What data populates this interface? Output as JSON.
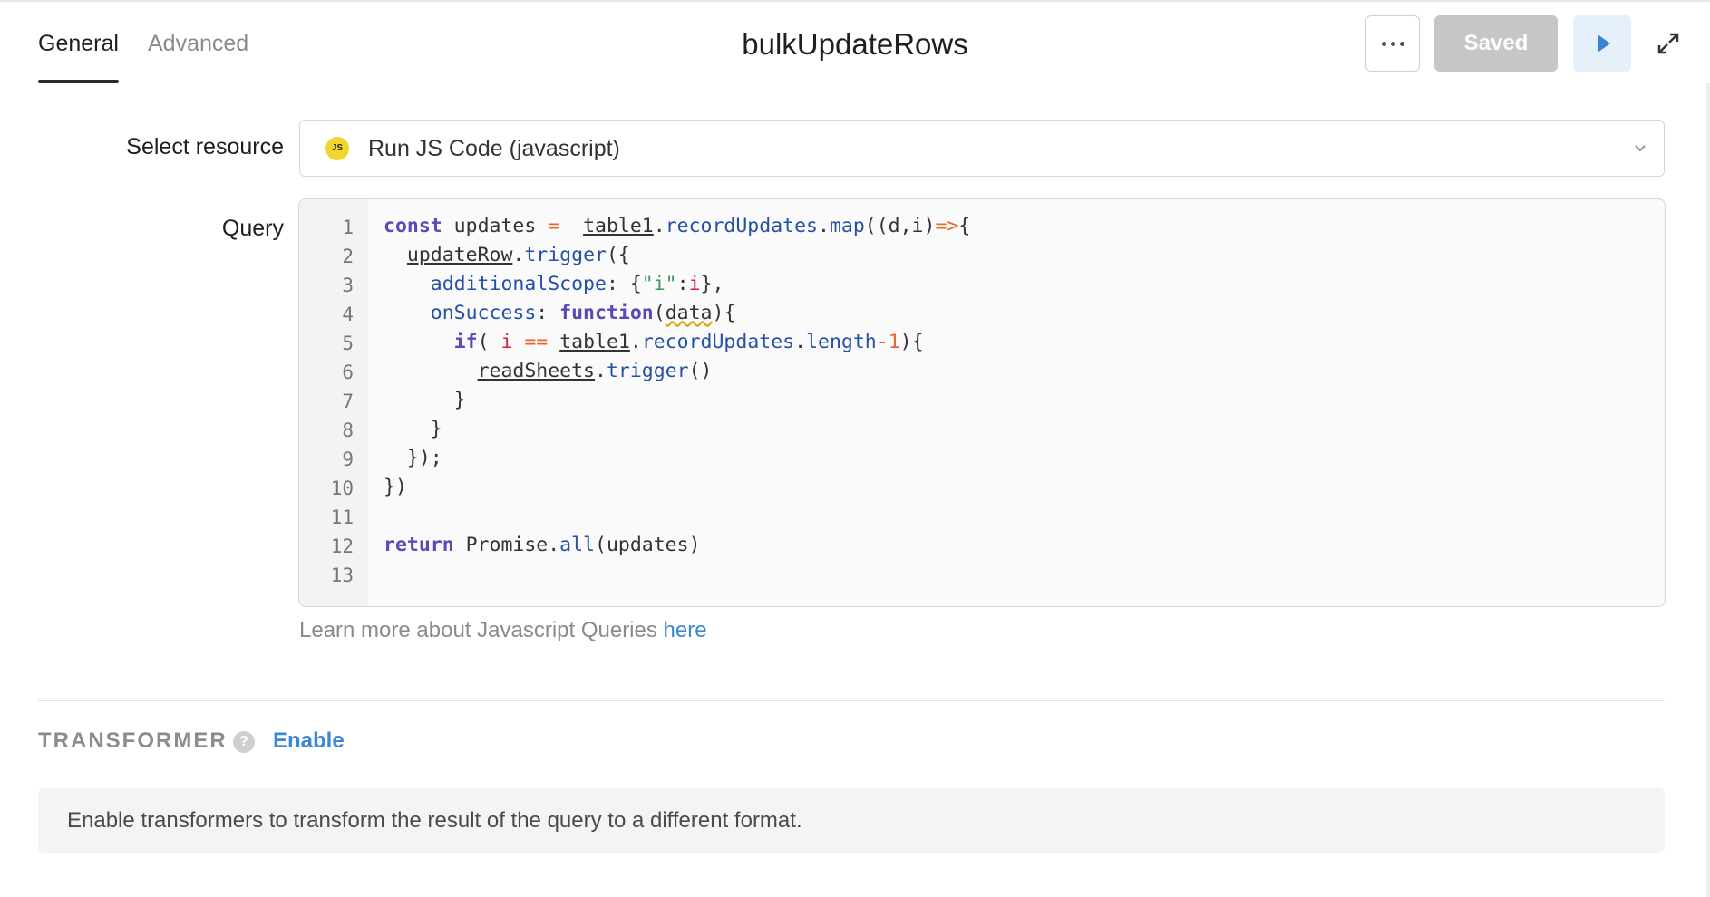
{
  "header": {
    "tabs": [
      {
        "label": "General",
        "active": true
      },
      {
        "label": "Advanced",
        "active": false
      }
    ],
    "title": "bulkUpdateRows",
    "more_icon": "ellipsis-icon",
    "saved_label": "Saved",
    "run_icon": "play-icon",
    "expand_icon": "expand-icon"
  },
  "form": {
    "resource_label": "Select resource",
    "resource": {
      "badge": "JS",
      "value": "Run JS Code (javascript)"
    },
    "query_label": "Query",
    "editor": {
      "line_numbers": [
        "1",
        "2",
        "3",
        "4",
        "5",
        "6",
        "7",
        "8",
        "9",
        "10",
        "11",
        "12",
        "13"
      ],
      "lines": [
        "const updates =  table1.recordUpdates.map((d,i)=>{",
        "  updateRow.trigger({",
        "    additionalScope: {\"i\":i},",
        "    onSuccess: function(data){",
        "      if( i == table1.recordUpdates.length-1){",
        "        readSheets.trigger()",
        "      }",
        "    }",
        "  });",
        "})",
        "",
        "return Promise.all(updates)",
        ""
      ]
    },
    "learn_more_text": "Learn more about Javascript Queries ",
    "learn_more_link": "here"
  },
  "transformer": {
    "heading": "TRANSFORMER",
    "help_icon": "question-icon",
    "enable_label": "Enable",
    "description": "Enable transformers to transform the result of the query to a different format."
  },
  "colors": {
    "accent": "#3b86d6",
    "saved_bg": "#c6c6c6",
    "run_bg": "#e6f0fb",
    "keyword": "#5a4ab8",
    "property": "#2550a8",
    "operator": "#e8672a",
    "string": "#3a9a55"
  }
}
